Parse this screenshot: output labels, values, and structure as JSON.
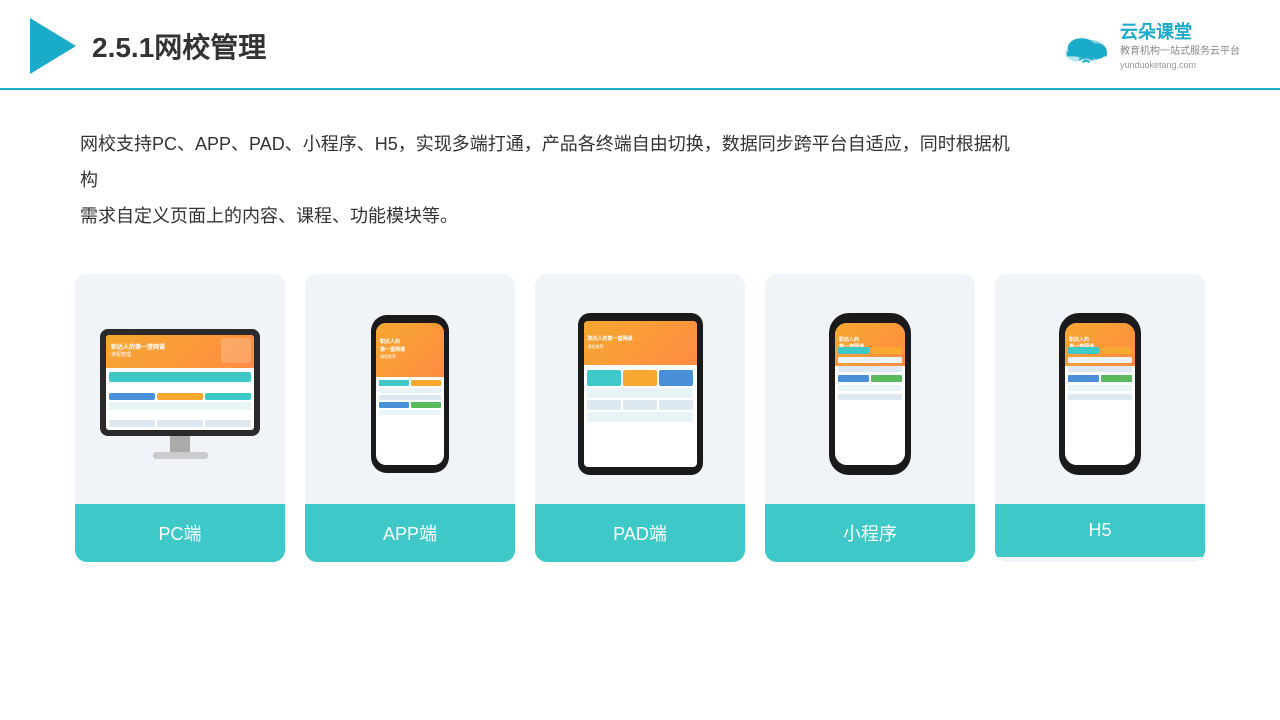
{
  "header": {
    "section_number": "2.5.1",
    "title": "网校管理",
    "brand": {
      "name": "云朵课堂",
      "url": "yunduoketang.com",
      "tagline_line1": "教育机构一站",
      "tagline_line2": "式服务云平台"
    }
  },
  "description": {
    "text": "网校支持PC、APP、PAD、小程序、H5，实现多端打通，产品各终端自由切换，数据同步跨平台自适应，同时根据机构",
    "text2": "需求自定义页面上的内容、课程、功能模块等。"
  },
  "cards": [
    {
      "id": "pc",
      "label": "PC端"
    },
    {
      "id": "app",
      "label": "APP端"
    },
    {
      "id": "pad",
      "label": "PAD端"
    },
    {
      "id": "miniapp",
      "label": "小程序"
    },
    {
      "id": "h5",
      "label": "H5"
    }
  ],
  "colors": {
    "teal": "#3ec8c8",
    "orange": "#f7a830",
    "blue": "#4a90d9",
    "accent": "#1aabca"
  }
}
